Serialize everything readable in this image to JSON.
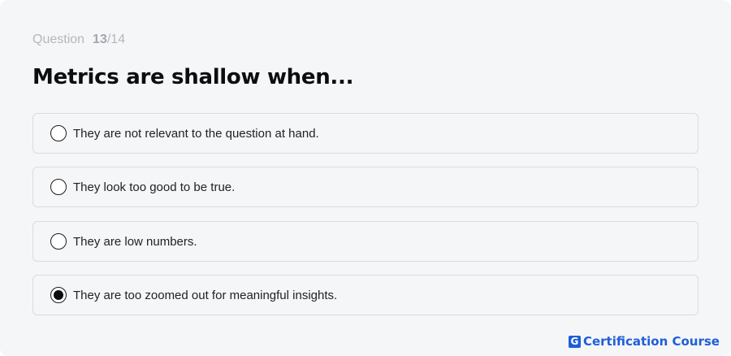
{
  "counter": {
    "label": "Question",
    "current": "13",
    "separator_total": "/14"
  },
  "question": {
    "title": "Metrics are shallow when..."
  },
  "options": [
    {
      "text": "They are not relevant to the question at hand.",
      "selected": false
    },
    {
      "text": "They look too good to be true.",
      "selected": false
    },
    {
      "text": "They are low numbers.",
      "selected": false
    },
    {
      "text": "They are too zoomed out for meaningful insights.",
      "selected": true
    }
  ],
  "brand": {
    "logo_letter": "G",
    "name": "Certification Course",
    "color": "#1f5ed8"
  }
}
